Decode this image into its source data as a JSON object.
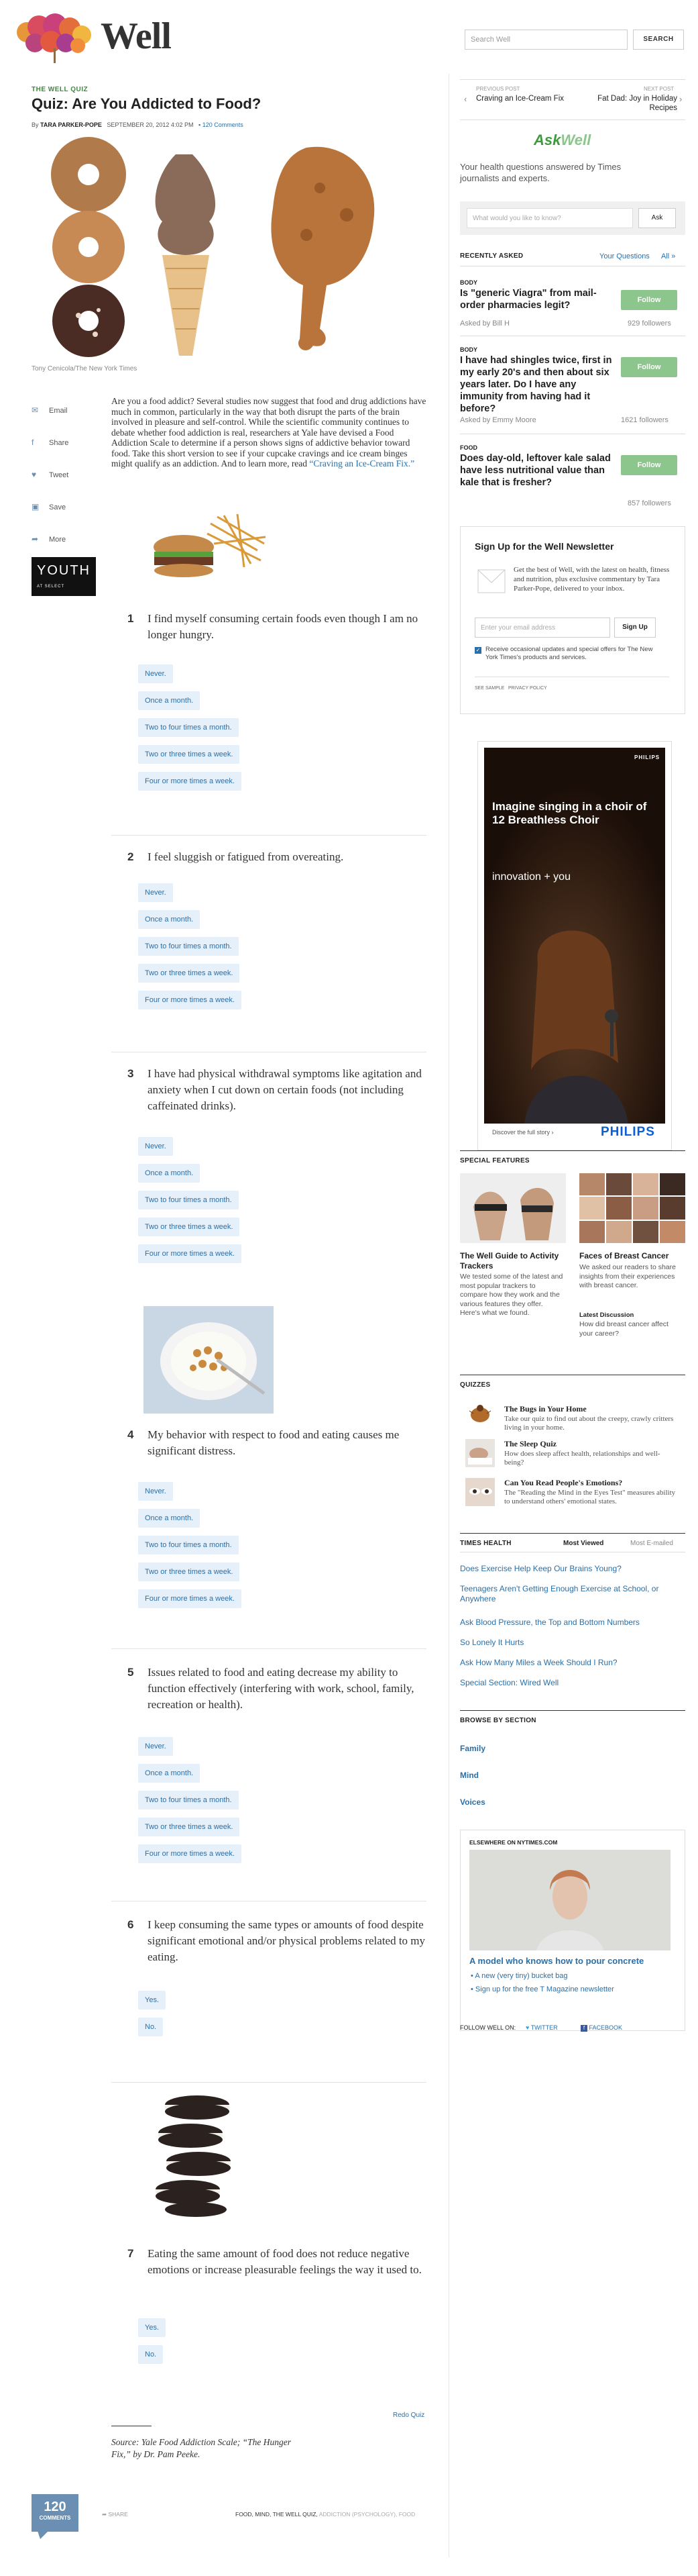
{
  "header": {
    "site_name": "Well",
    "search_placeholder": "Search Well",
    "search_button": "SEARCH"
  },
  "article": {
    "kicker": "THE WELL QUIZ",
    "title": "Quiz: Are You Addicted to Food?",
    "byline_prefix": "By",
    "author": "TARA PARKER-POPE",
    "date": "SEPTEMBER 20, 2012 4:02 PM",
    "comments_link": "120 Comments",
    "photo_credit": "Tony Cenicola/The New York Times",
    "intro_text": "Are you a food addict? Several studies now suggest that food and drug addictions have much in common, particularly in the way that both disrupt the parts of the brain involved in pleasure and self-control. While the scientific community continues to debate whether food addiction is real, researchers at Yale have devised a Food Addiction Scale to determine if a person shows signs of addictive behavior toward food. Take this short version to see if your cupcake cravings and ice cream binges might qualify as an addiction. And to learn more, read ",
    "intro_link": "“Craving an Ice-Cream Fix.”",
    "source_note": "Source: Yale Food Addiction Scale; “The Hunger Fix,” by Dr. Pam Peeke.",
    "redo_quiz": "Redo Quiz",
    "comments_badge_count": "120",
    "comments_badge_label": "COMMENTS",
    "share_footer": "SHARE",
    "tags": "FOOD, MIND, THE WELL QUIZ,",
    "tags_faded": "ADDICTION (PSYCHOLOGY), FOOD"
  },
  "share_tools": {
    "email": "Email",
    "share": "Share",
    "tweet": "Tweet",
    "save": "Save",
    "more": "More"
  },
  "ad_youth": {
    "title": "YOUTH",
    "subtitle": "AT SELECT THEATERS"
  },
  "options_frequency": [
    "Never.",
    "Once a month.",
    "Two to four times a month.",
    "Two or three times a week.",
    "Four or more times a week."
  ],
  "options_yesno": [
    "Yes.",
    "No."
  ],
  "questions": [
    {
      "num": "1",
      "text": "I find myself consuming certain foods even though I am no longer hungry."
    },
    {
      "num": "2",
      "text": "I feel sluggish or fatigued from overeating."
    },
    {
      "num": "3",
      "text": "I have had physical withdrawal symptoms like agitation and anxiety when I cut down on certain foods (not including caffeinated drinks)."
    },
    {
      "num": "4",
      "text": "My behavior with respect to food and eating causes me significant distress."
    },
    {
      "num": "5",
      "text": "Issues related to food and eating decrease my ability to function effectively (interfering with work, school, family, recreation or health)."
    },
    {
      "num": "6",
      "text": "I keep consuming the same types or amounts of food despite significant emotional and/or physical problems related to my eating."
    },
    {
      "num": "7",
      "text": "Eating the same amount of food does not reduce negative emotions or increase pleasurable feelings the way it used to."
    }
  ],
  "post_nav": {
    "prev_label": "PREVIOUS POST",
    "prev_title": "Craving an Ice-Cream Fix",
    "next_label": "NEXT POST",
    "next_title": "Fat Dad: Joy in Holiday Recipes"
  },
  "askwell": {
    "logo_ask": "Ask",
    "logo_well": "Well",
    "tagline": "Your health questions answered by Times journalists and experts.",
    "input_placeholder": "What would you like to know?",
    "ask_button": "Ask",
    "recently_asked": "RECENTLY ASKED",
    "your_questions": "Your Questions",
    "all_link": "All »",
    "items": [
      {
        "category": "BODY",
        "question": "Is \"generic Viagra\" from mail-order pharmacies legit?",
        "asker": "Asked by Bill H",
        "followers": "929 followers",
        "follow": "Follow"
      },
      {
        "category": "BODY",
        "question": "I have had shingles twice, first in my early 20's and then about six years later. Do I have any immunity from having had it before?",
        "asker": "Asked by Emmy Moore",
        "followers": "1621 followers",
        "follow": "Follow"
      },
      {
        "category": "FOOD",
        "question": "Does day-old, leftover kale salad have less nutritional value than kale that is fresher?",
        "asker": "",
        "followers": "857 followers",
        "follow": "Follow"
      }
    ]
  },
  "newsletter": {
    "title": "Sign Up for the Well Newsletter",
    "description": "Get the best of Well, with the latest on health, fitness and nutrition, plus exclusive commentary by Tara Parker-Pope, delivered to your inbox.",
    "email_placeholder": "Enter your email address",
    "signup_button": "Sign Up",
    "checkbox_text": "Receive occasional updates and special offers for The New York Times's products and services.",
    "see_sample": "SEE SAMPLE",
    "privacy": "PRIVACY POLICY"
  },
  "ad_philips": {
    "small_logo": "PHILIPS",
    "headline": "Imagine singing in a choir of 12 Breathless Choir",
    "tagline": "innovation + you",
    "discover": "Discover the full story ›",
    "brand": "PHILIPS"
  },
  "special_features": {
    "heading": "SPECIAL FEATURES",
    "items": [
      {
        "title": "The Well Guide to Activity Trackers",
        "desc": "We tested some of the latest and most popular trackers to compare how they work and the various features they offer. Here's what we found."
      },
      {
        "title": "Faces of Breast Cancer",
        "desc": "We asked our readers to share insights from their experiences with breast cancer.",
        "sub_label": "Latest Discussion",
        "sub_desc": "How did breast cancer affect your career?"
      }
    ]
  },
  "quizzes": {
    "heading": "QUIZZES",
    "items": [
      {
        "title": "The Bugs in Your Home",
        "desc": "Take our quiz to find out about the creepy, crawly critters living in your home."
      },
      {
        "title": "The Sleep Quiz",
        "desc": "How does sleep affect health, relationships and well-being?"
      },
      {
        "title": "Can You Read People's Emotions?",
        "desc": "The \"Reading the Mind in the Eyes Test\" measures ability to understand others' emotional states."
      }
    ]
  },
  "times_health": {
    "heading": "TIMES HEALTH",
    "tab_viewed": "Most Viewed",
    "tab_emailed": "Most E-mailed",
    "links": [
      "Does Exercise Help Keep Our Brains Young?",
      "Teenagers Aren't Getting Enough Exercise at School, or Anywhere",
      "Ask Blood Pressure, the Top and Bottom Numbers",
      "So Lonely It Hurts",
      "Ask How Many Miles a Week Should I Run?",
      "Special Section: Wired Well"
    ]
  },
  "browse": {
    "heading": "BROWSE BY SECTION",
    "links": [
      "Family",
      "Mind",
      "Voices"
    ]
  },
  "elsewhere": {
    "heading": "ELSEWHERE ON NYTIMES.COM",
    "headline": "A model who knows how to pour concrete",
    "bullets": [
      "A new (very tiny) bucket bag",
      "Sign up for the free T Magazine newsletter"
    ]
  },
  "follow_well": {
    "label": "FOLLOW WELL ON:",
    "twitter": "TWITTER",
    "facebook": "FACEBOOK"
  },
  "colors": {
    "accent_link": "#2a6fa8",
    "option_bg": "#e6f0fa",
    "follow_green": "#8cc68c",
    "askwell_green": "#3d9a3d",
    "philips_blue": "#0b5ed7"
  }
}
